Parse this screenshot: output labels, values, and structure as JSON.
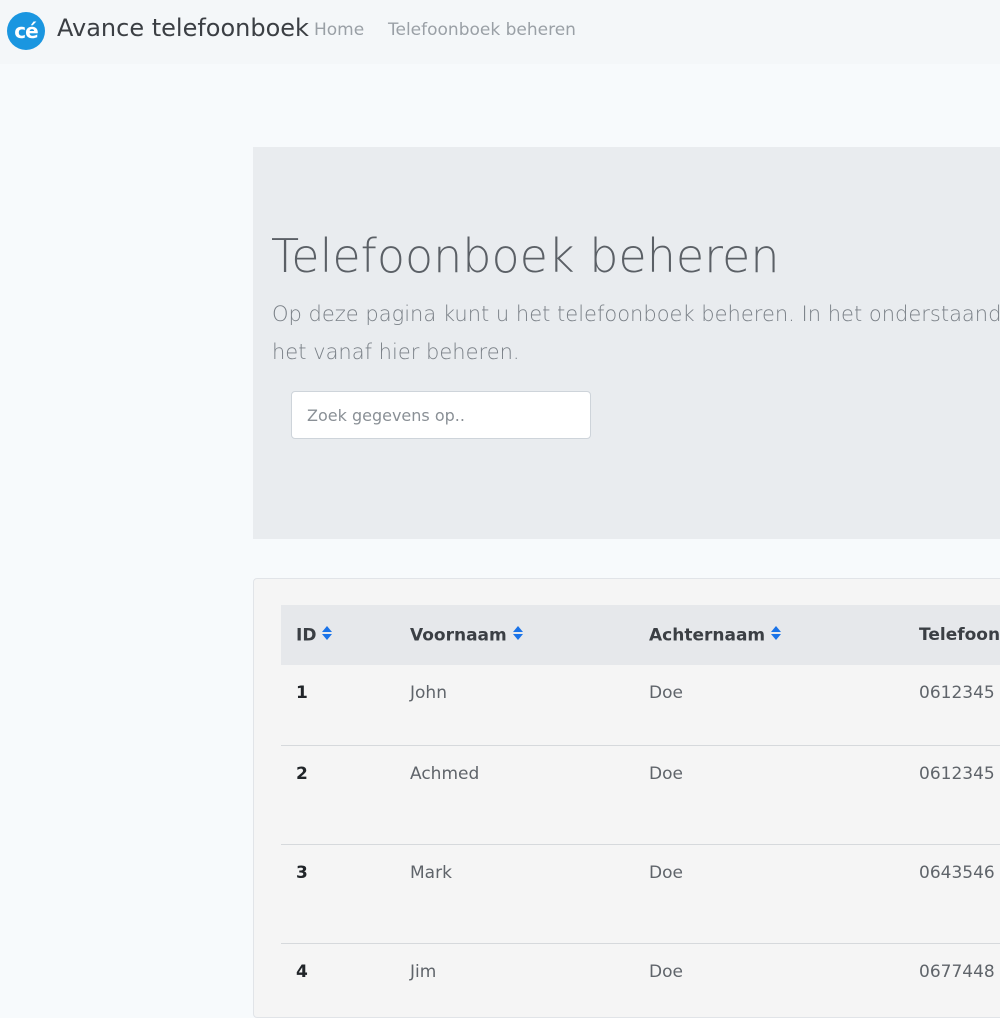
{
  "navbar": {
    "logo_text": "cé",
    "brand": "Avance telefoonboek",
    "links": [
      "Home",
      "Telefoonboek beheren"
    ]
  },
  "jumbotron": {
    "title": "Telefoonboek beheren",
    "text": "Op deze pagina kunt u het telefoonboek beheren. In het onderstaand boek en kunt u het vanaf hier beheren.",
    "search_placeholder": "Zoek gegevens op.."
  },
  "table": {
    "headers": [
      "ID",
      "Voornaam",
      "Achternaam",
      "Telefoonr"
    ],
    "rows": [
      {
        "id": "1",
        "first": "John",
        "last": "Doe",
        "phone": "0612345"
      },
      {
        "id": "2",
        "first": "Achmed",
        "last": "Doe",
        "phone": "0612345"
      },
      {
        "id": "3",
        "first": "Mark",
        "last": "Doe",
        "phone": "0643546"
      },
      {
        "id": "4",
        "first": "Jim",
        "last": "Doe",
        "phone": "0677448"
      }
    ]
  },
  "colors": {
    "accent": "#1a96e0",
    "sort_icon": "#1a73e8",
    "jumbotron_bg": "#e9ecef"
  },
  "icons": {
    "sort": "sort-icon"
  }
}
